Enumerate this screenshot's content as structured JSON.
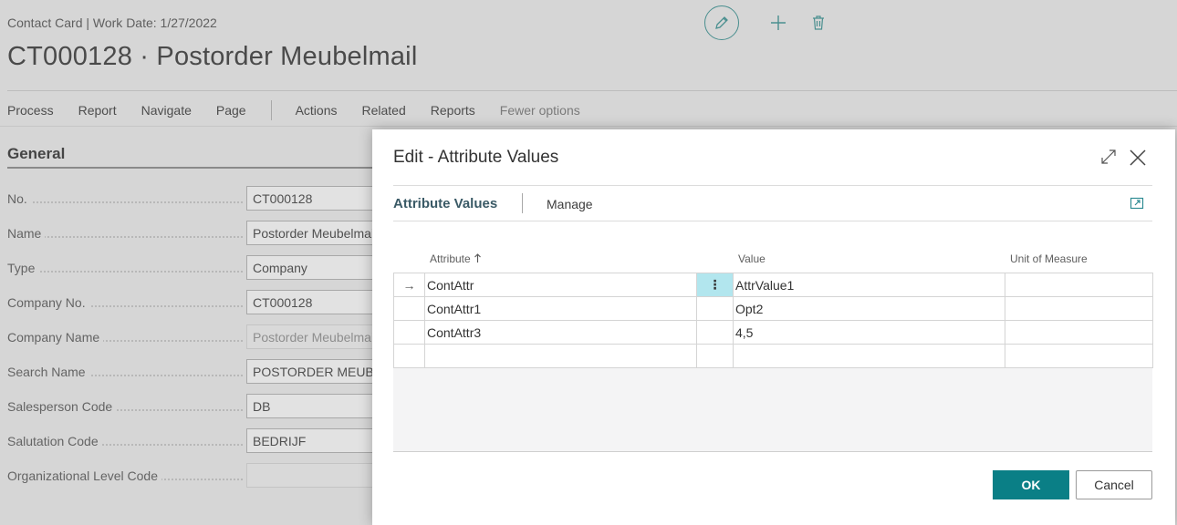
{
  "page": {
    "subtitle": "Contact Card | Work Date: 1/27/2022",
    "title": "CT000128 · Postorder Meubelmail",
    "actions": {
      "process": "Process",
      "report": "Report",
      "navigate": "Navigate",
      "page": "Page",
      "actions": "Actions",
      "related": "Related",
      "reports": "Reports",
      "fewer_options": "Fewer options"
    },
    "section_title": "General",
    "fields": [
      {
        "label": "No.",
        "value": "CT000128"
      },
      {
        "label": "Name",
        "value": "Postorder Meubelmail"
      },
      {
        "label": "Type",
        "value": "Company"
      },
      {
        "label": "Company No.",
        "value": "CT000128"
      },
      {
        "label": "Company Name",
        "value": "Postorder Meubelmail"
      },
      {
        "label": "Search Name",
        "value": "POSTORDER MEUBELMAIL"
      },
      {
        "label": "Salesperson Code",
        "value": "DB"
      },
      {
        "label": "Salutation Code",
        "value": "BEDRIJF"
      },
      {
        "label": "Organizational Level Code",
        "value": ""
      }
    ]
  },
  "icons": {
    "edit": "pencil-icon",
    "new": "plus-icon",
    "delete": "trash-icon",
    "expand": "expand-icon",
    "close": "close-icon",
    "open_page": "open-in-new-window-icon",
    "row_marker": "arrow-right-icon",
    "sort": "arrow-up-icon"
  },
  "dialog": {
    "title": "Edit - Attribute Values",
    "tabs": {
      "active": "Attribute Values",
      "manage": "Manage"
    },
    "columns": {
      "attribute": "Attribute",
      "value": "Value",
      "unit": "Unit of Measure"
    },
    "rows": [
      {
        "marker": "→",
        "attribute": "ContAttr",
        "value": "AttrValue1",
        "unit": ""
      },
      {
        "marker": "",
        "attribute": "ContAttr1",
        "value": "Opt2",
        "unit": ""
      },
      {
        "marker": "",
        "attribute": "ContAttr3",
        "value": "4,5",
        "unit": ""
      },
      {
        "marker": "",
        "attribute": "",
        "value": "",
        "unit": ""
      }
    ],
    "kebab": "⋮",
    "ok_label": "OK",
    "cancel_label": "Cancel"
  },
  "colors": {
    "accent": "#0a7f86",
    "selected_cell": "#b2e6ee"
  }
}
